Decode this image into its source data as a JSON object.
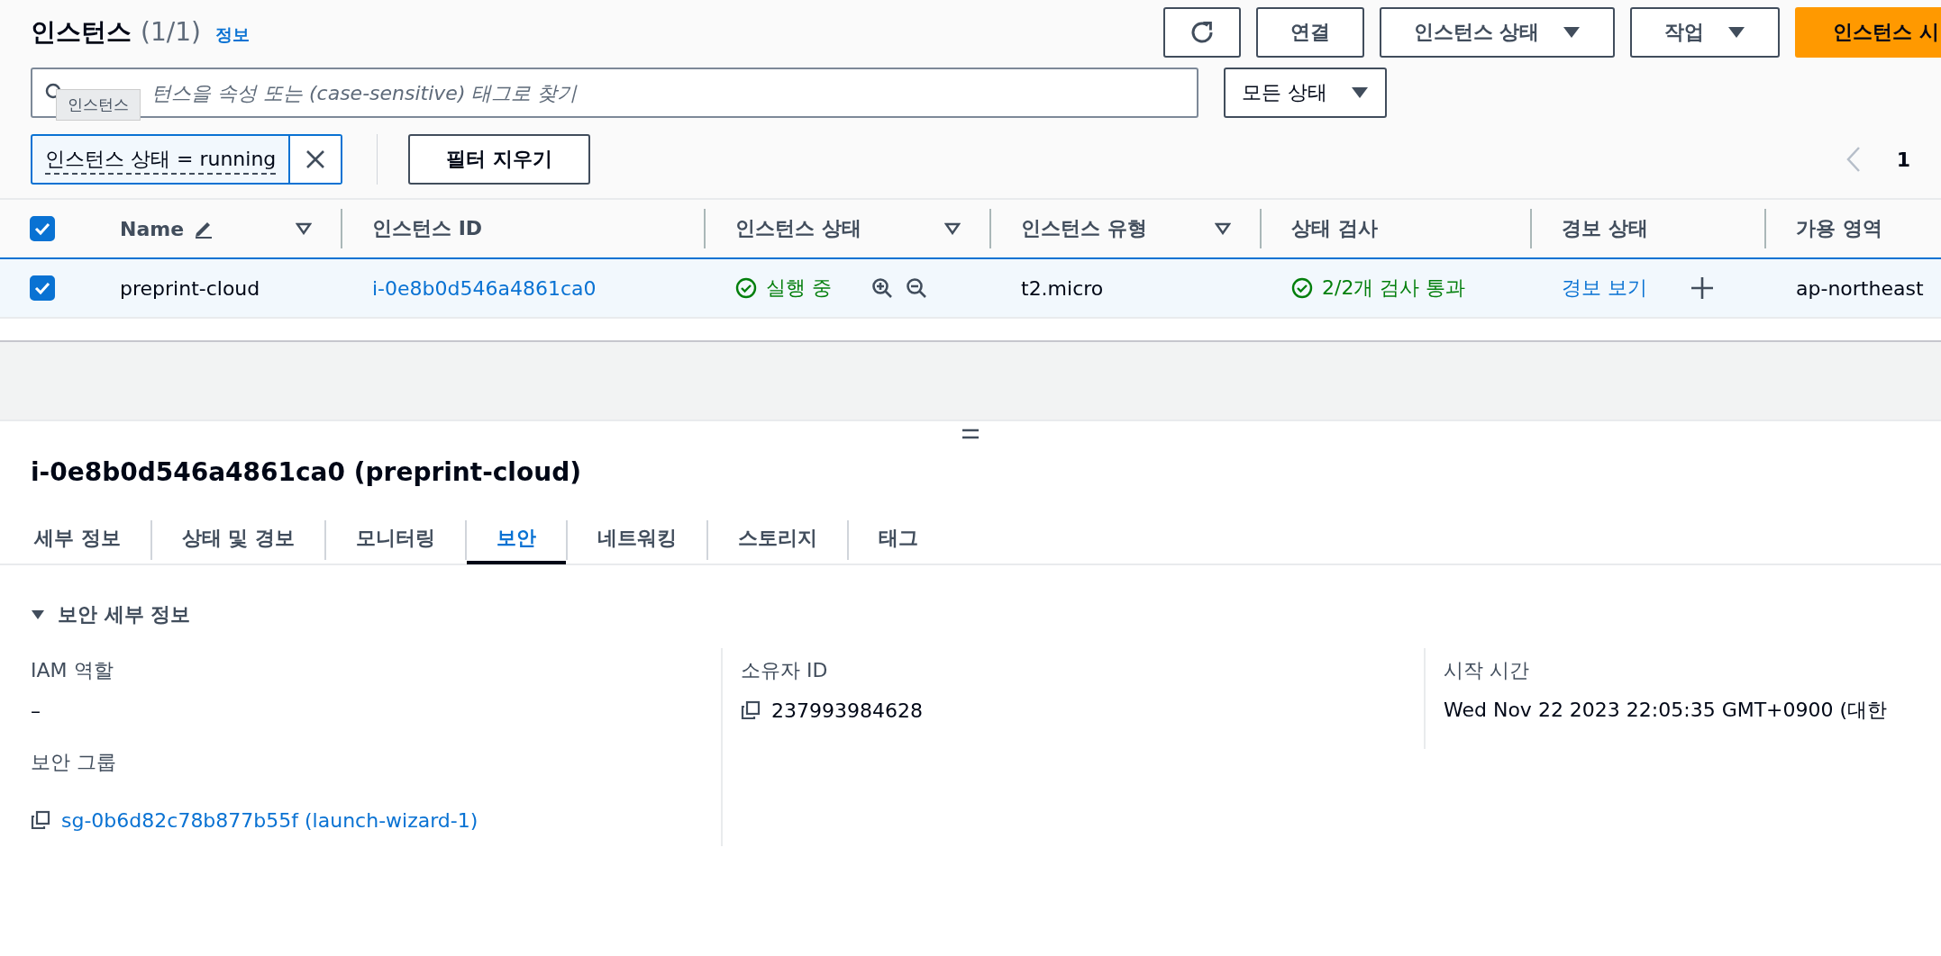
{
  "header": {
    "title": "인스턴스",
    "count": "(1/1)",
    "info_link": "정보"
  },
  "actions": [
    {
      "kind": "refresh"
    },
    {
      "kind": "button",
      "label": "연결"
    },
    {
      "kind": "dropdown",
      "label": "인스턴스 상태"
    },
    {
      "kind": "dropdown",
      "label": "작업"
    },
    {
      "kind": "primary",
      "label": "인스턴스 시"
    }
  ],
  "search": {
    "placeholder": "턴스을 속성 또는 (case-sensitive) 태그로 찾기",
    "tooltip": "인스턴스"
  },
  "state_filter": {
    "value": "모든 상태"
  },
  "filter_tokens": [
    {
      "label": "인스턴스 상태 = running"
    }
  ],
  "clear_filters": "필터 지우기",
  "pagination": {
    "page": "1"
  },
  "table": {
    "select_all_checked": true,
    "columns": [
      {
        "label": "Name",
        "editable": true,
        "sortable": true
      },
      {
        "label": "인스턴스 ID",
        "editable": false,
        "sortable": false
      },
      {
        "label": "인스턴스 상태",
        "editable": false,
        "sortable": true
      },
      {
        "label": "인스턴스 유형",
        "editable": false,
        "sortable": true
      },
      {
        "label": "상태 검사",
        "editable": false,
        "sortable": false
      },
      {
        "label": "경보 상태",
        "editable": false,
        "sortable": false
      },
      {
        "label": "가용 영역",
        "editable": false,
        "sortable": false
      }
    ],
    "rows": [
      {
        "checked": true,
        "selected": true,
        "name": "preprint-cloud",
        "instance_id": "i-0e8b0d546a4861ca0",
        "state": "실행 중",
        "type": "t2.micro",
        "status_check": "2/2개 검사 통과",
        "alarm": "경보 보기",
        "az": "ap-northeast"
      }
    ]
  },
  "details": {
    "title": "i-0e8b0d546a4861ca0 (preprint-cloud)",
    "tabs": [
      {
        "label": "세부 정보",
        "selected": false
      },
      {
        "label": "상태 및 경보",
        "selected": false
      },
      {
        "label": "모니터링",
        "selected": false
      },
      {
        "label": "보안",
        "selected": true
      },
      {
        "label": "네트워킹",
        "selected": false
      },
      {
        "label": "스토리지",
        "selected": false
      },
      {
        "label": "태그",
        "selected": false
      }
    ],
    "section": {
      "title": "보안 세부 정보",
      "expanded": true
    },
    "columns": [
      [
        {
          "label": "IAM 역할",
          "value": "–",
          "copyable": false,
          "link": false
        },
        {
          "label": "보안 그룹",
          "value": "sg-0b6d82c78b877b55f (launch-wizard-1)",
          "copyable": true,
          "link": true
        }
      ],
      [
        {
          "label": "소유자 ID",
          "value": "237993984628",
          "copyable": true,
          "link": false
        }
      ],
      [
        {
          "label": "시작 시간",
          "value": "Wed Nov 22 2023 22:05:35 GMT+0900 (대한",
          "copyable": false,
          "link": false
        }
      ]
    ]
  }
}
